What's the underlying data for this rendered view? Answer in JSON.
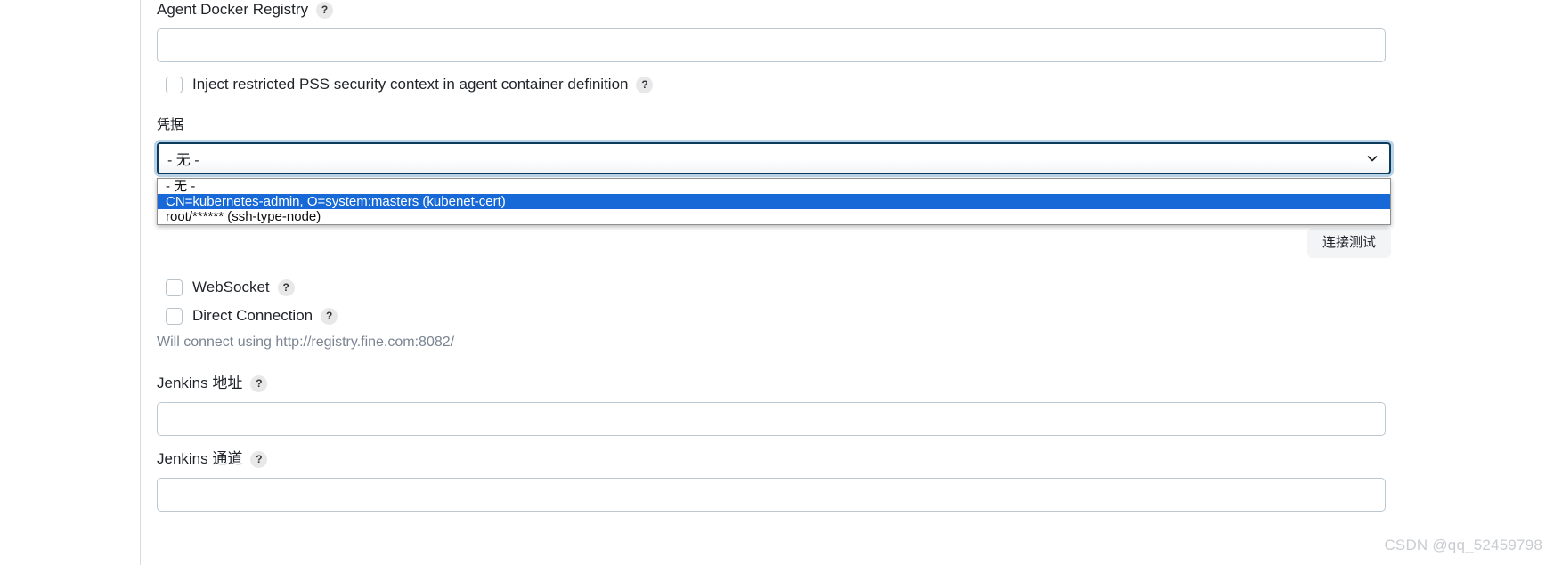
{
  "form": {
    "registry": {
      "label": "Agent Docker Registry",
      "help": "?",
      "value": "",
      "placeholder": ""
    },
    "pss_checkbox": {
      "label": "Inject restricted PSS security context in agent container definition",
      "help": "?",
      "checked": false
    },
    "credentials": {
      "label": "凭据",
      "selected": "- 无 -",
      "chevron": "chevron-down-icon",
      "options": [
        {
          "label": "- 无 -",
          "highlighted": false
        },
        {
          "label": "CN=kubernetes-admin, O=system:masters (kubenet-cert)",
          "highlighted": true
        },
        {
          "label": "root/****** (ssh-type-node)",
          "highlighted": false
        }
      ],
      "highlight_color": "#1669d6",
      "focus_ring_color": "#b9d3e8",
      "border_color": "#0b3c5d"
    },
    "test_button": {
      "label": "连接测试"
    },
    "websocket_checkbox": {
      "label": "WebSocket",
      "help": "?",
      "checked": false
    },
    "direct_connection_checkbox": {
      "label": "Direct Connection",
      "help": "?",
      "checked": false
    },
    "connect_hint": "Will connect using http://registry.fine.com:8082/",
    "jenkins_url": {
      "label": "Jenkins 地址",
      "help": "?",
      "value": "",
      "placeholder": ""
    },
    "jenkins_tunnel": {
      "label": "Jenkins 通道",
      "help": "?",
      "value": "",
      "placeholder": ""
    }
  },
  "watermark": "CSDN @qq_52459798"
}
